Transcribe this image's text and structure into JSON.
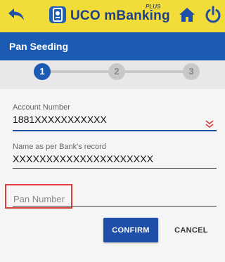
{
  "header": {
    "app_name": "UCO mBanking",
    "app_badge": "PLUS",
    "icons": {
      "back": "back-arrow-icon",
      "home": "home-icon",
      "power": "power-icon",
      "logo": "uco-logo-icon"
    },
    "colors": {
      "background": "#f2dc3a",
      "icon": "#1f4fa8"
    }
  },
  "page": {
    "title": "Pan Seeding",
    "title_bar_color": "#1b5bb3"
  },
  "stepper": {
    "steps": [
      {
        "label": "1",
        "state": "active"
      },
      {
        "label": "2",
        "state": "inactive"
      },
      {
        "label": "3",
        "state": "inactive"
      }
    ],
    "active_color": "#1b5bb3"
  },
  "form": {
    "account_number": {
      "label": "Account Number",
      "value": "1881XXXXXXXXXXX",
      "icon": "chevron-down-icon"
    },
    "name": {
      "label": "Name as per Bank's record",
      "value": "XXXXXXXXXXXXXXXXXXXXX"
    },
    "pan_number": {
      "placeholder": "Pan Number",
      "value": ""
    }
  },
  "actions": {
    "confirm_label": "CONFIRM",
    "cancel_label": "CANCEL"
  }
}
